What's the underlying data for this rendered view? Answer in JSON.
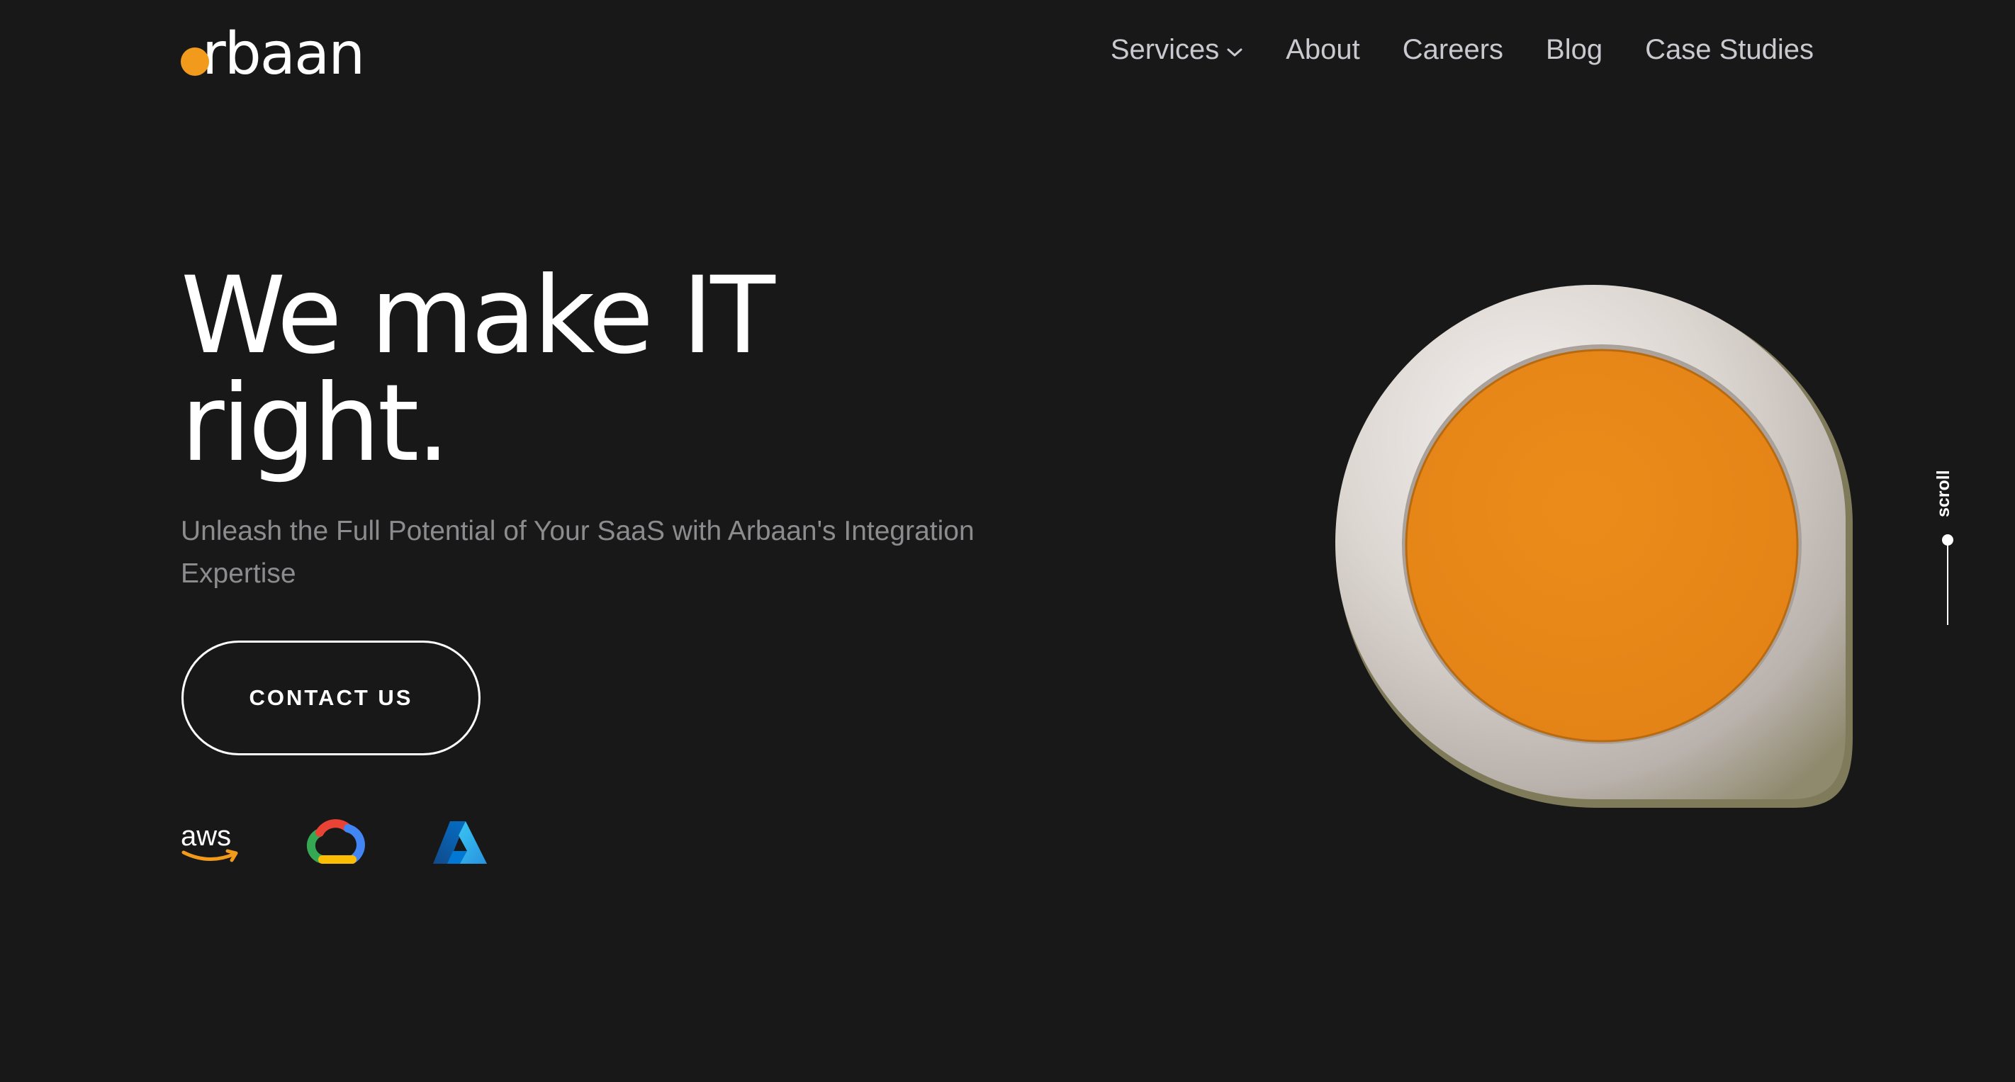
{
  "brand": {
    "name": "arbaan",
    "logo_text": "rbaan",
    "accent_color": "#f29a1c"
  },
  "nav": {
    "items": [
      {
        "label": "Services",
        "has_dropdown": true
      },
      {
        "label": "About"
      },
      {
        "label": "Careers"
      },
      {
        "label": "Blog"
      },
      {
        "label": "Case Studies"
      }
    ]
  },
  "hero": {
    "title_line1": "We make IT",
    "title_line2": "right.",
    "subtitle": "Unleash the Full Potential of Your SaaS with Arbaan's Integration Expertise",
    "cta_label": "CONTACT US"
  },
  "cloud_logos": {
    "aws_text": "aws",
    "items": [
      "aws-logo",
      "google-cloud-logo",
      "azure-logo"
    ]
  },
  "scroll_indicator": {
    "label": "scroll"
  },
  "colors": {
    "background": "#181818",
    "pin_orange": "#e8861a",
    "pin_shell": "#d8d2cc"
  }
}
